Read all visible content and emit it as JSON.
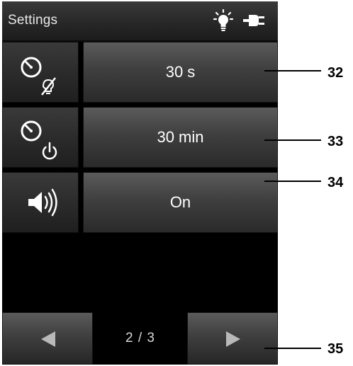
{
  "status_bar": {
    "title": "Settings",
    "icons": [
      "light-bulb-icon",
      "power-plug-icon"
    ]
  },
  "rows": [
    {
      "icon": "backlight-timer-icon",
      "value": "30 s",
      "callout": "32"
    },
    {
      "icon": "auto-off-timer-icon",
      "value": "30 min",
      "callout": "33"
    },
    {
      "icon": "speaker-sound-icon",
      "value": "On",
      "callout": "34"
    }
  ],
  "nav": {
    "prev_icon": "arrow-left-icon",
    "next_icon": "arrow-right-icon",
    "page_indicator": "2 / 3",
    "callout": "35"
  },
  "colors": {
    "screen_bg": "#000000",
    "button_top": "#5b5b5b",
    "button_bottom": "#2a2a2a",
    "text": "#ffffff"
  }
}
